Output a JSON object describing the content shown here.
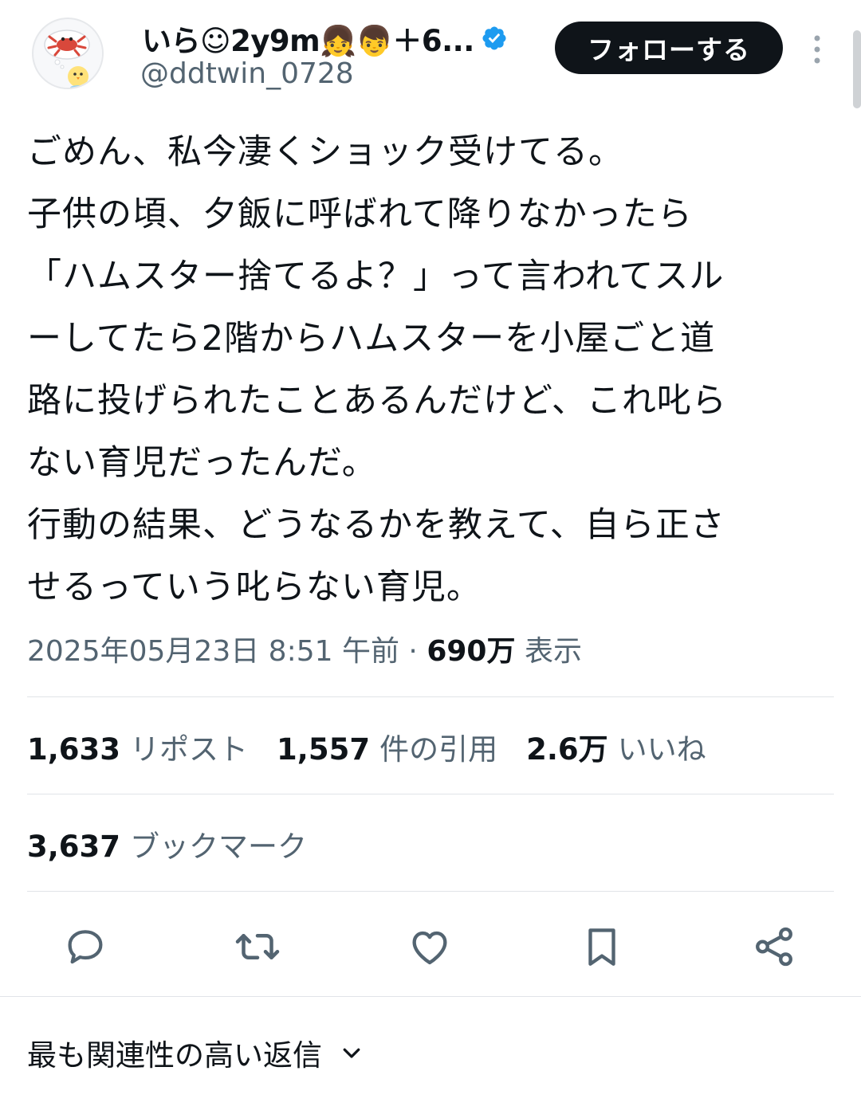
{
  "author": {
    "display_name": "いら☺2y9m👧👦＋6...",
    "handle": "@ddtwin_0728",
    "verified": true,
    "avatar_icon": "crab-and-chick-avatar"
  },
  "follow_button": {
    "label": "フォローする"
  },
  "more_icon": "more-vertical-icon",
  "tweet": {
    "text": "ごめん、私今凄くショック受けてる。\n子供の頃、夕飯に呼ばれて降りなかったら\n「ハムスター捨てるよ？」って言われてスル\nーしてたら2階からハムスターを小屋ごと道\n路に投げられたことあるんだけど、これ叱ら\nない育児だったんだ。\n行動の結果、どうなるかを教えて、自ら正さ\nせるっていう叱らない育児。",
    "timestamp": "2025年05月23日 8:51 午前",
    "separator": "·",
    "views_count": "690万",
    "views_label": "表示"
  },
  "stats": {
    "reposts": {
      "count": "1,633",
      "label": "リポスト"
    },
    "quotes": {
      "count": "1,557",
      "label": "件の引用"
    },
    "likes": {
      "count": "2.6万",
      "label": "いいね"
    },
    "bookmarks": {
      "count": "3,637",
      "label": "ブックマーク"
    }
  },
  "actions": [
    {
      "name": "reply",
      "icon": "reply-icon"
    },
    {
      "name": "repost",
      "icon": "repost-icon"
    },
    {
      "name": "like",
      "icon": "heart-icon"
    },
    {
      "name": "bookmark",
      "icon": "bookmark-icon"
    },
    {
      "name": "share",
      "icon": "share-icon"
    }
  ],
  "replies_sort": {
    "label": "最も関連性の高い返信"
  },
  "colors": {
    "text_primary": "#0f1419",
    "text_secondary": "#536471",
    "verified_blue": "#1d9bf0",
    "follow_button_bg": "#0f1419",
    "divider": "#e1e4e8"
  }
}
